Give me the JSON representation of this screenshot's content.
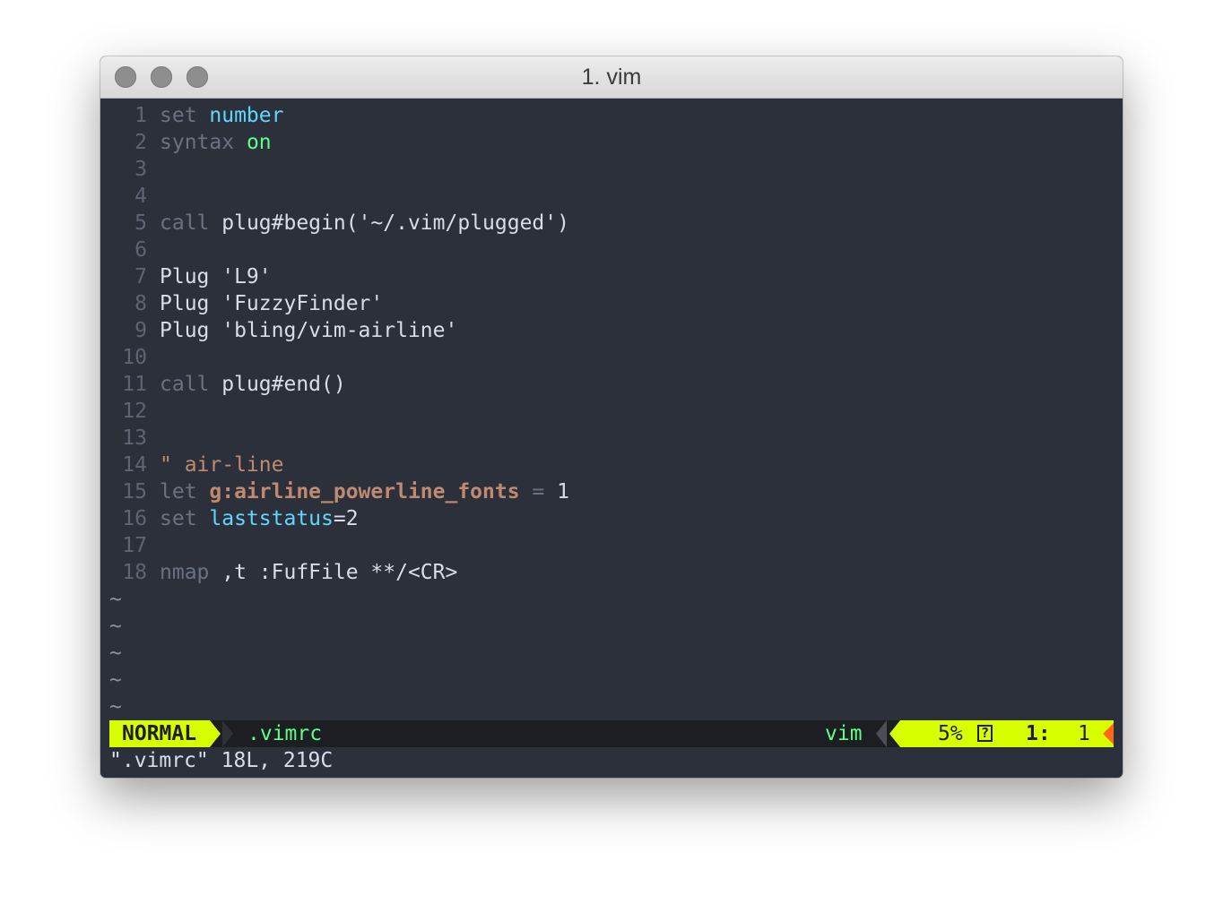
{
  "window": {
    "title": "1. vim"
  },
  "editor": {
    "lines": [
      {
        "num": "1",
        "parts": [
          {
            "t": "set ",
            "c": "kw"
          },
          {
            "t": "number",
            "c": "cyan"
          }
        ]
      },
      {
        "num": "2",
        "parts": [
          {
            "t": "syntax ",
            "c": "kw"
          },
          {
            "t": "on",
            "c": "green"
          }
        ]
      },
      {
        "num": "3",
        "parts": []
      },
      {
        "num": "4",
        "parts": []
      },
      {
        "num": "5",
        "parts": [
          {
            "t": "call ",
            "c": "kw"
          },
          {
            "t": "plug#begin('~/.vim/plugged')",
            "c": "plain"
          }
        ]
      },
      {
        "num": "6",
        "parts": []
      },
      {
        "num": "7",
        "parts": [
          {
            "t": "Plug 'L9'",
            "c": "plain"
          }
        ]
      },
      {
        "num": "8",
        "parts": [
          {
            "t": "Plug 'FuzzyFinder'",
            "c": "plain"
          }
        ]
      },
      {
        "num": "9",
        "parts": [
          {
            "t": "Plug 'bling/vim-airline'",
            "c": "plain"
          }
        ]
      },
      {
        "num": "10",
        "parts": []
      },
      {
        "num": "11",
        "parts": [
          {
            "t": "call ",
            "c": "kw"
          },
          {
            "t": "plug#end()",
            "c": "plain"
          }
        ]
      },
      {
        "num": "12",
        "parts": []
      },
      {
        "num": "13",
        "parts": []
      },
      {
        "num": "14",
        "parts": [
          {
            "t": "\" air-line",
            "c": "comment"
          }
        ]
      },
      {
        "num": "15",
        "parts": [
          {
            "t": "let ",
            "c": "kw"
          },
          {
            "t": "g:airline_powerline_fonts",
            "c": "var"
          },
          {
            "t": " = ",
            "c": "kw"
          },
          {
            "t": "1",
            "c": "plain"
          }
        ]
      },
      {
        "num": "16",
        "parts": [
          {
            "t": "set ",
            "c": "kw"
          },
          {
            "t": "laststatus",
            "c": "cyan"
          },
          {
            "t": "=2",
            "c": "plain"
          }
        ]
      },
      {
        "num": "17",
        "parts": []
      },
      {
        "num": "18",
        "parts": [
          {
            "t": "nmap ",
            "c": "kw"
          },
          {
            "t": ",t :FufFile **/<CR>",
            "c": "plain"
          }
        ]
      }
    ],
    "tilde_rows": [
      "~",
      "~",
      "~",
      "~",
      "~"
    ]
  },
  "statusline": {
    "mode": "NORMAL",
    "filename": ".vimrc",
    "filetype": "vim",
    "percent": "5%",
    "help_box": "?",
    "line": "1:",
    "col": "1"
  },
  "cmdline": {
    "text": "\".vimrc\" 18L, 219C"
  },
  "colors": {
    "background": "#2c303b",
    "statusline_accent": "#d7ff00",
    "keyword": "#6a7282",
    "option": "#5fd7ff",
    "value_green": "#5fff87",
    "comment": "#c08a70"
  }
}
